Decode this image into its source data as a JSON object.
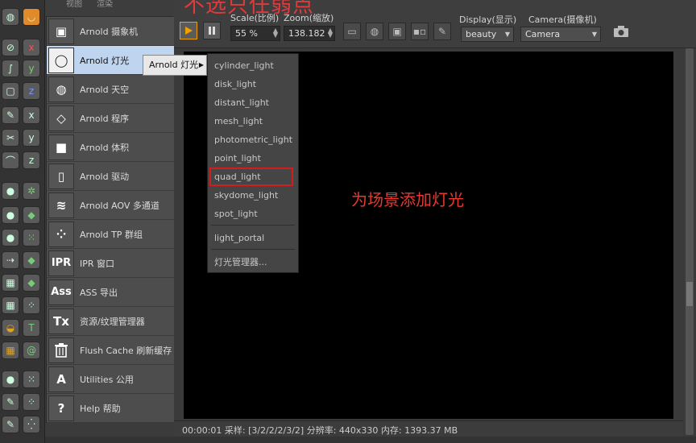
{
  "overlay": {
    "title": "不选只任弱点",
    "annotation": "为场景添加灯光"
  },
  "top_menu": {
    "item1": "视图",
    "item2": "渲染"
  },
  "arnold_menu": {
    "items": [
      {
        "label": "Arnold 摄象机",
        "icon": "camera-icon",
        "glyph": "▣"
      },
      {
        "label": "Arnold 灯光",
        "icon": "light-bulb-icon",
        "glyph": "◯"
      },
      {
        "label": "Arnold 天空",
        "icon": "sky-sphere-icon",
        "glyph": "◍"
      },
      {
        "label": "Arnold 程序",
        "icon": "procedural-cube-icon",
        "glyph": "◇"
      },
      {
        "label": "Arnold 体积",
        "icon": "volume-cube-icon",
        "glyph": "■"
      },
      {
        "label": "Arnold 驱动",
        "icon": "driver-document-icon",
        "glyph": "▯"
      },
      {
        "label": "Arnold AOV 多通道",
        "icon": "aov-layers-icon",
        "glyph": "≋"
      },
      {
        "label": "Arnold TP 群组",
        "icon": "tp-group-icon",
        "glyph": "⁘"
      },
      {
        "label": "IPR 窗口",
        "icon": "ipr-icon",
        "glyph": "IPR"
      },
      {
        "label": "ASS 导出",
        "icon": "ass-export-icon",
        "glyph": "Ass"
      },
      {
        "label": "资源/纹理管理器",
        "icon": "texture-manager-icon",
        "glyph": "Tx"
      },
      {
        "label": "Flush Cache 刷新缓存",
        "icon": "trash-icon",
        "glyph": "🗑"
      },
      {
        "label": "Utilities 公用",
        "icon": "utilities-icon",
        "glyph": "A"
      },
      {
        "label": "Help 帮助",
        "icon": "help-icon",
        "glyph": "?"
      }
    ]
  },
  "toolbar": {
    "scale_label": "Scale(比例)",
    "scale_value": "55 %",
    "zoom_label": "Zoom(缩放)",
    "zoom_value": "138.182",
    "display_label": "Display(显示)",
    "display_value": "beauty",
    "camera_label": "Camera(摄像机)",
    "camera_value": "Camera"
  },
  "submenu_parent": "Arnold 灯光",
  "light_menu": {
    "items": [
      "cylinder_light",
      "disk_light",
      "distant_light",
      "mesh_light",
      "photometric_light",
      "point_light",
      "quad_light",
      "skydome_light",
      "spot_light"
    ],
    "extra": "light_portal",
    "manager": "灯光管理器...",
    "highlighted": "quad_light"
  },
  "statusbar": {
    "text": "00:00:01  采样: [3/2/2/2/3/2]  分辨率: 440x330  内存: 1393.37 MB"
  },
  "colors": {
    "accent": "#f0a000",
    "annotation": "#e8382f",
    "active_item": "#bfd4ef"
  }
}
